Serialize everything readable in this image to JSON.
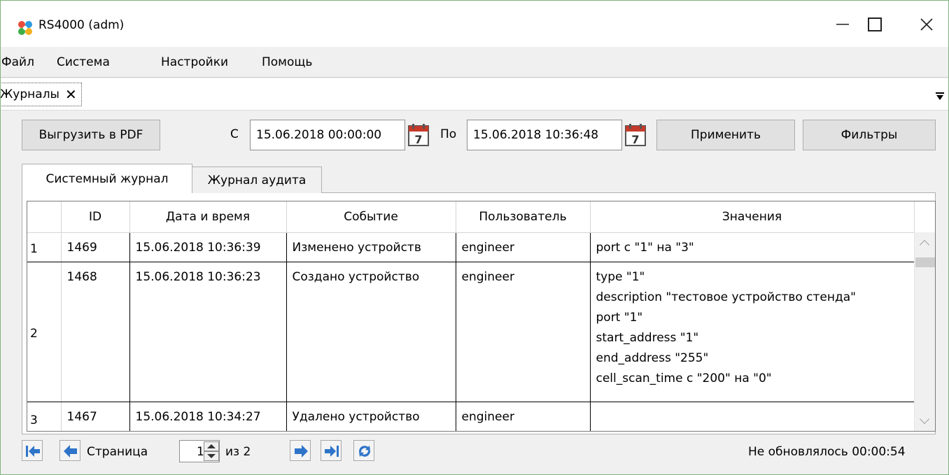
{
  "window": {
    "title": "RS4000 (adm)"
  },
  "menu": [
    "Файл",
    "Система",
    "Настройки",
    "Помощь"
  ],
  "doc_tab": {
    "label": "Журналы"
  },
  "toolbar": {
    "export_label": "Выгрузить в PDF",
    "from_label": "С",
    "from_value": "15.06.2018 00:00:00",
    "to_label": "По",
    "to_value": "15.06.2018 10:36:48",
    "apply_label": "Применить",
    "filters_label": "Фильтры"
  },
  "subtabs": [
    "Системный журнал",
    "Журнал аудита"
  ],
  "table": {
    "columns": [
      "ID",
      "Дата и время",
      "Событие",
      "Пользователь",
      "Значения"
    ],
    "rows": [
      {
        "num": "1",
        "id": "1469",
        "datetime": "15.06.2018 10:36:39",
        "event": "Изменено устройств",
        "user": "engineer",
        "values": [
          "port с \"1\" на \"3\""
        ]
      },
      {
        "num": "2",
        "id": "1468",
        "datetime": "15.06.2018 10:36:23",
        "event": "Создано устройство",
        "user": "engineer",
        "values": [
          "type \"1\"",
          "description \"тестовое устройство стенда\"",
          "port \"1\"",
          "start_address \"1\"",
          "end_address \"255\"",
          "cell_scan_time с \"200\" на \"0\""
        ]
      },
      {
        "num": "3",
        "id": "1467",
        "datetime": "15.06.2018 10:34:27",
        "event": "Удалено устройство",
        "user": "engineer",
        "values": []
      }
    ]
  },
  "pager": {
    "page_label": "Страница",
    "page_value": "1",
    "of_label": "из 2"
  },
  "status": "Не обновлялось 00:00:54",
  "colors": {
    "accent": "#2e74c9",
    "window_border": "#7fb27f"
  }
}
